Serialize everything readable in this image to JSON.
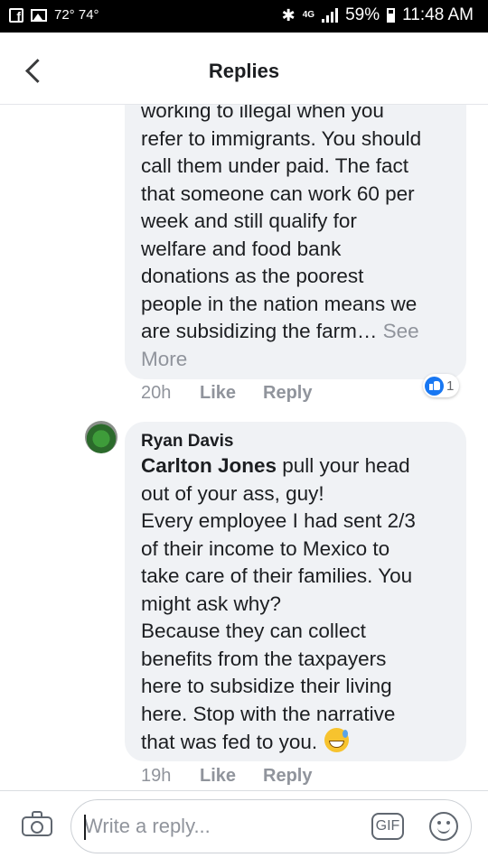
{
  "status_bar": {
    "temps": "72° 74°",
    "network": "4G",
    "battery": "59%",
    "time": "11:48 AM"
  },
  "header": {
    "title": "Replies",
    "back_icon": "chevron-left-icon"
  },
  "comments": [
    {
      "text_lines": [
        "working to illegal when you",
        "refer to immigrants. You should",
        "call them under paid.  The fact",
        "that someone can work 60 per",
        "week and still qualify for",
        "welfare and food bank",
        "donations as the poorest",
        "people in the nation means we",
        "are subsidizing the farm… "
      ],
      "see_more": "See More",
      "time": "20h",
      "like_label": "Like",
      "reply_label": "Reply",
      "reaction_count": "1",
      "reaction_icon": "like-icon"
    },
    {
      "author": "Ryan Davis",
      "mention": "Carlton Jones",
      "text_lines": [
        " pull your head",
        "out of your ass, guy!",
        "Every employee I had sent 2/3",
        "of their income to Mexico to",
        "take care of their families. You",
        "might ask why?",
        "Because they can collect",
        "benefits from the taxpayers",
        "here to subsidize their living",
        "here. Stop with the narrative",
        "that was fed to you. "
      ],
      "emoji_icon": "grinning-sweat-emoji",
      "time": "19h",
      "like_label": "Like",
      "reply_label": "Reply"
    }
  ],
  "composer": {
    "placeholder": "Write a reply...",
    "gif_label": "GIF",
    "camera_icon": "camera-icon",
    "emoji_icon": "smiley-icon"
  }
}
